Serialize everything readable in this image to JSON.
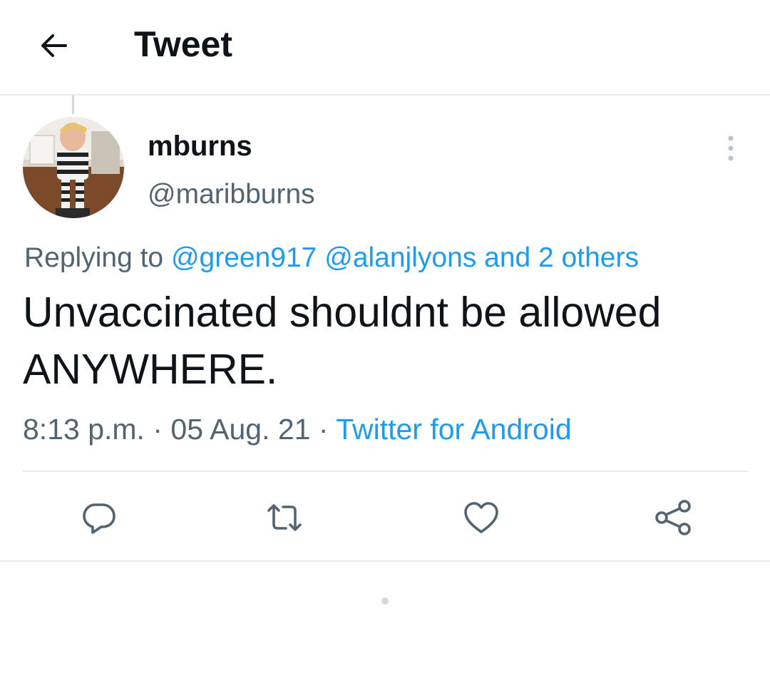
{
  "header": {
    "title": "Tweet",
    "back_icon": "arrow-left-icon"
  },
  "author": {
    "display_name": "mburns",
    "handle": "@maribburns",
    "avatar_icon": "profile-photo"
  },
  "reply": {
    "prefix": "Replying to",
    "mention_1": "@green917",
    "mention_2": "@alanjlyons",
    "others": "and 2 others"
  },
  "tweet": {
    "text_line_1": "Unvaccinated shouldnt be allowed",
    "text_line_2": "ANYWHERE."
  },
  "meta": {
    "time": "8:13 p.m.",
    "separator": "·",
    "date": "05 Aug. 21",
    "source": "Twitter for Android"
  },
  "actions": {
    "reply_icon": "reply-icon",
    "retweet_icon": "retweet-icon",
    "like_icon": "heart-icon",
    "share_icon": "share-icon"
  },
  "colors": {
    "link": "#1d9bf0",
    "text": "#0f1419",
    "secondary": "#536471",
    "divider": "#e7ecf0"
  }
}
